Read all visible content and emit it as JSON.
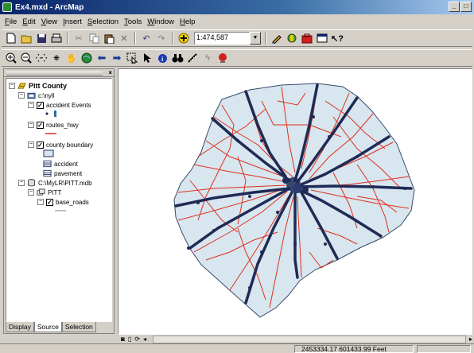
{
  "window": {
    "title": "Ex4.mxd - ArcMap",
    "min_label": "_",
    "max_label": "□"
  },
  "menu": [
    "File",
    "Edit",
    "View",
    "Insert",
    "Selection",
    "Tools",
    "Window",
    "Help"
  ],
  "toolbar": {
    "scale_value": "1:474,587",
    "scale_dropdown": "▼"
  },
  "toc": {
    "close_label": "×",
    "items": [
      {
        "label": "Pitt County"
      },
      {
        "label": "c:\\nyll"
      },
      {
        "label": "accident Events"
      },
      {
        "label": "routes_hwy"
      },
      {
        "label": "county boundary"
      },
      {
        "label": "accident"
      },
      {
        "label": "pavement"
      },
      {
        "label": "C:\\MyLR\\PITT.mdb"
      },
      {
        "label": "PITT"
      },
      {
        "label": "base_roads"
      }
    ],
    "tabs": [
      "Display",
      "Source",
      "Selection"
    ]
  },
  "status": {
    "coordinates": "2453334.17  601433.99 Feet"
  },
  "colors": {
    "county_fill": "#d7e6ef",
    "base_roads": "#e0301e",
    "routes_hwy": "#1f2a55",
    "title_bar": "#0a246a"
  }
}
